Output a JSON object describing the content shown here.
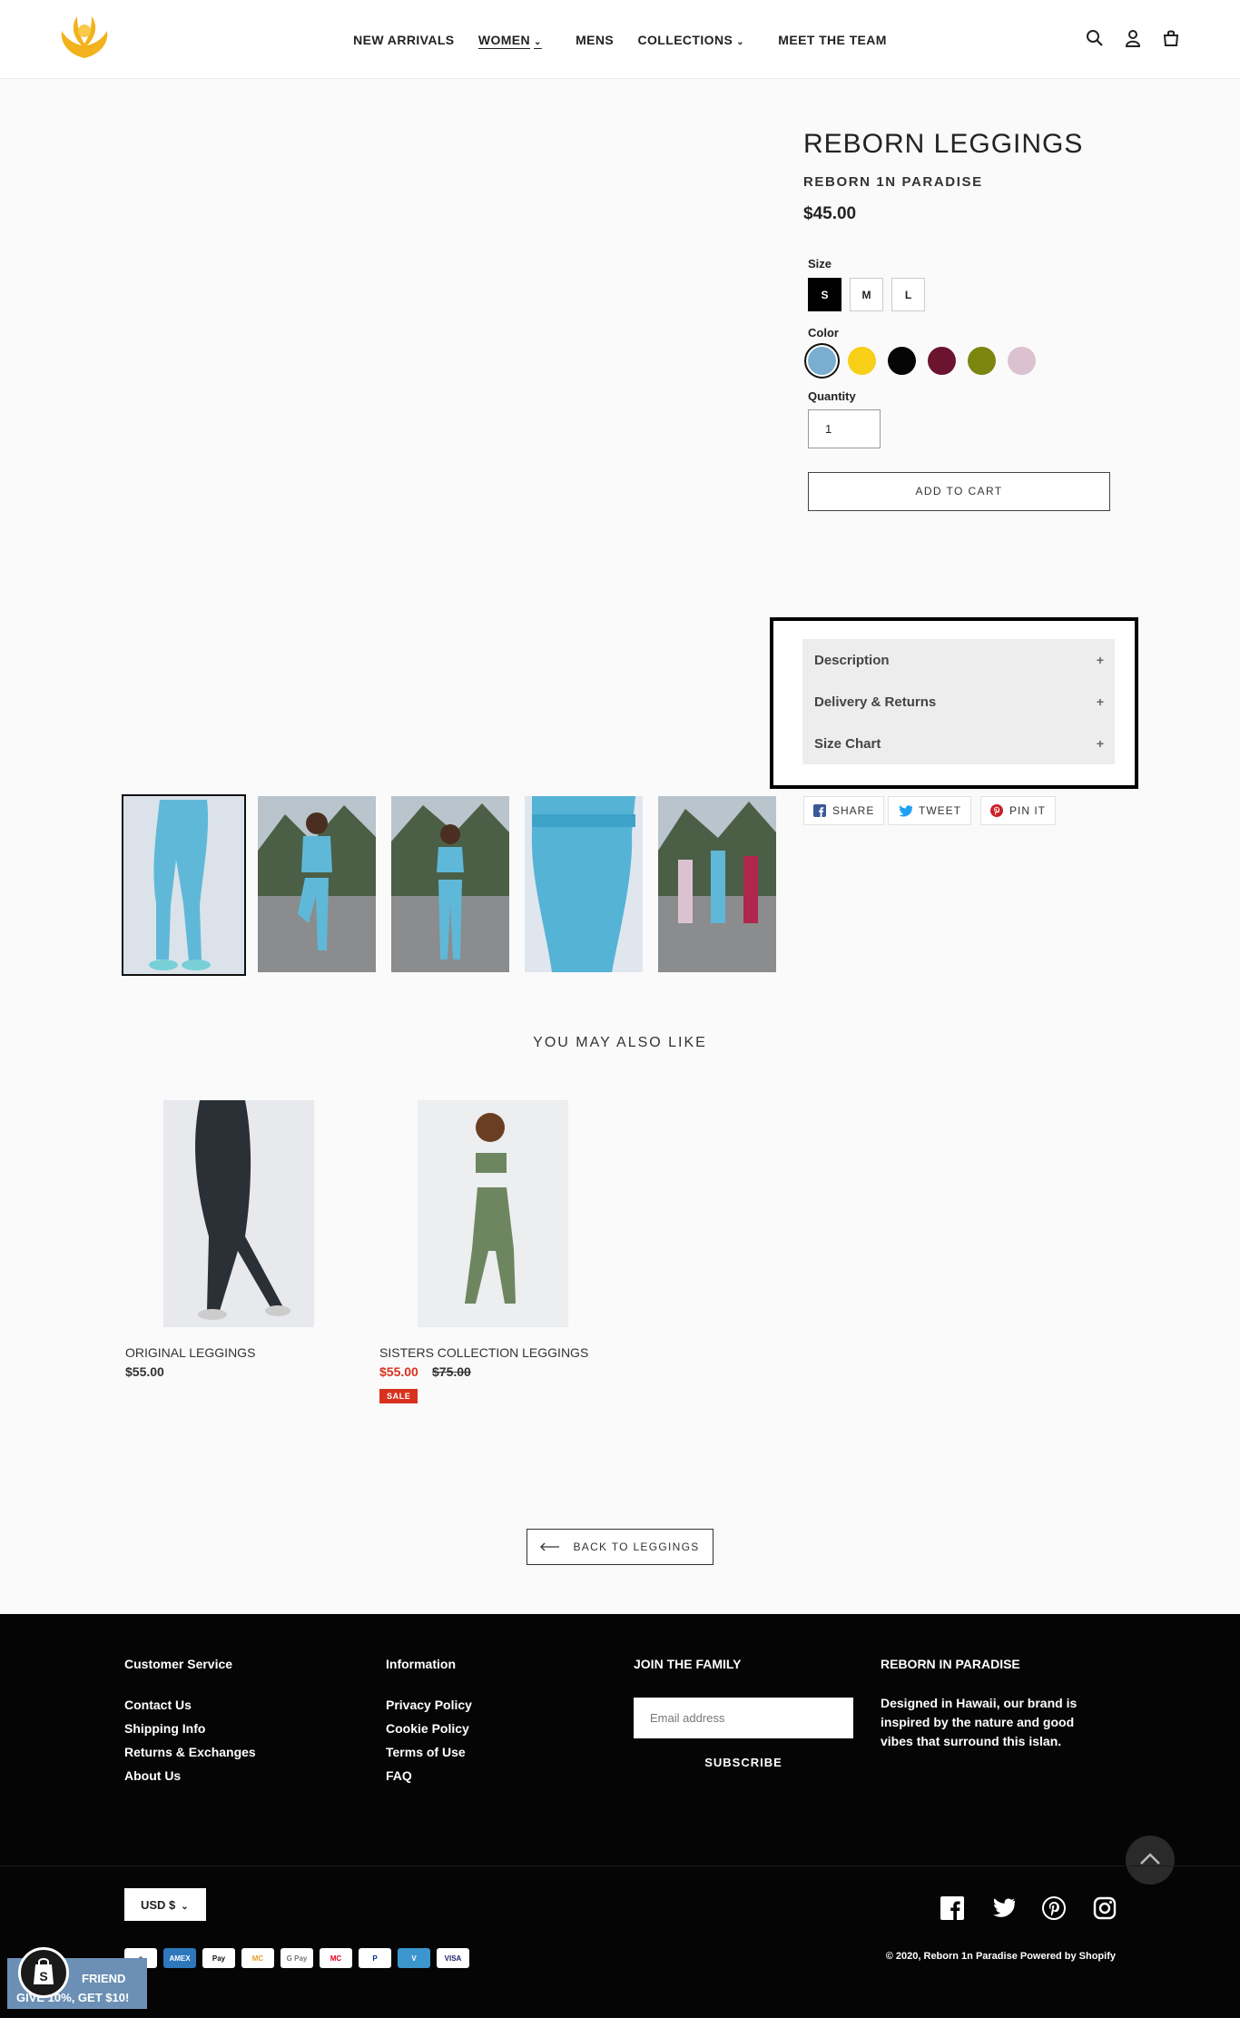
{
  "header": {
    "nav": [
      {
        "label": "NEW ARRIVALS",
        "dropdown": false
      },
      {
        "label": "WOMEN",
        "dropdown": true,
        "active": true
      },
      {
        "label": "MENS",
        "dropdown": false
      },
      {
        "label": "COLLECTIONS",
        "dropdown": true
      },
      {
        "label": "MEET THE TEAM",
        "dropdown": false
      }
    ],
    "icons": [
      "search-icon",
      "account-icon",
      "cart-icon"
    ],
    "logo_color": "#f3b21b"
  },
  "product": {
    "title": "REBORN LEGGINGS",
    "vendor": "REBORN 1N PARADISE",
    "price": "$45.00",
    "size_label": "Size",
    "sizes": [
      "S",
      "M",
      "L"
    ],
    "selected_size": "S",
    "color_label": "Color",
    "colors": [
      "#79aed0",
      "#f8cf17",
      "#050505",
      "#6a1430",
      "#7c860e",
      "#dcc2d1"
    ],
    "selected_color": "#79aed0",
    "quantity_label": "Quantity",
    "quantity": "1",
    "add_to_cart": "ADD TO CART"
  },
  "accordion": [
    {
      "label": "Description",
      "icon": "+"
    },
    {
      "label": "Delivery & Returns",
      "icon": "+"
    },
    {
      "label": "Size Chart",
      "icon": "+"
    }
  ],
  "share": [
    {
      "label": "SHARE",
      "icon": "facebook-icon",
      "color": "#3b5998"
    },
    {
      "label": "TWEET",
      "icon": "twitter-icon",
      "color": "#1da1f2"
    },
    {
      "label": "PIN IT",
      "icon": "pinterest-icon",
      "color": "#cb2027"
    }
  ],
  "related": {
    "heading": "YOU MAY ALSO LIKE",
    "items": [
      {
        "name": "ORIGINAL LEGGINGS",
        "price": "$55.00"
      },
      {
        "name": "SISTERS COLLECTION LEGGINGS",
        "price": "$55.00",
        "compare_price": "$75.00",
        "badge": "SALE"
      }
    ]
  },
  "back_link": {
    "label": "BACK TO LEGGINGS"
  },
  "footer": {
    "col1": {
      "title": "Customer Service",
      "links": [
        "Contact Us",
        "Shipping Info",
        "Returns & Exchanges",
        "About Us"
      ]
    },
    "col2": {
      "title": "Information",
      "links": [
        "Privacy Policy",
        "Cookie Policy",
        "Terms of Use",
        "FAQ"
      ]
    },
    "col3": {
      "title": "JOIN THE FAMILY",
      "email_placeholder": "Email address",
      "subscribe": "SUBSCRIBE"
    },
    "col4": {
      "title": "REBORN IN PARADISE",
      "text": "Designed in Hawaii, our brand is inspired by the nature and good vibes that surround this islan."
    },
    "currency": "USD $",
    "payment_methods": [
      "a",
      "AMEX",
      "Pay",
      "MC",
      "G Pay",
      "MC",
      "P",
      "V",
      "VISA"
    ],
    "copyright": "© 2020, Reborn 1n Paradise Powered by Shopify"
  },
  "promo": {
    "line1": "FRIEND",
    "line2": "GIVE 10%, GET $10!"
  }
}
